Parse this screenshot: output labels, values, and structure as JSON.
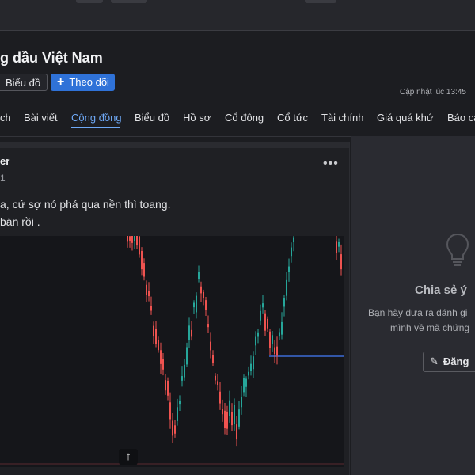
{
  "header": {
    "title": "g dầu Việt Nam",
    "chart_button": "Biểu đồ",
    "follow_button": "Theo dõi",
    "follow_icon": "plus-icon",
    "updated": "Cập nhật lúc  13:45"
  },
  "tabs": [
    {
      "label": "ch",
      "active": false
    },
    {
      "label": "Bài viết",
      "active": false
    },
    {
      "label": "Cộng đồng",
      "active": true
    },
    {
      "label": "Biểu đồ",
      "active": false
    },
    {
      "label": "Hồ sơ",
      "active": false
    },
    {
      "label": "Cổ đông",
      "active": false
    },
    {
      "label": "Cổ tức",
      "active": false
    },
    {
      "label": "Tài chính",
      "active": false
    },
    {
      "label": "Giá quá khứ",
      "active": false
    },
    {
      "label": "Báo cá",
      "active": false
    }
  ],
  "post": {
    "author": "er",
    "date": "1",
    "more_icon": "more-icon",
    "lines": [
      "a, cứ sợ nó phá qua nền thì toang.",
      "bán rồi ."
    ],
    "chart_icon": "arrow-up-icon"
  },
  "share": {
    "icon": "lightbulb-icon",
    "title": "Chia sẻ ý",
    "desc1": "Bạn hãy đưa ra đánh gi",
    "desc2": "mình về mã chứng",
    "button_label": "Đăng",
    "button_icon": "pencil-icon"
  },
  "colors": {
    "accent": "#2f72d8",
    "active_tab": "#6ea8f5",
    "candle_up": "#26a69a",
    "candle_down": "#ef5350",
    "reference_line": "#3d6bd6"
  }
}
